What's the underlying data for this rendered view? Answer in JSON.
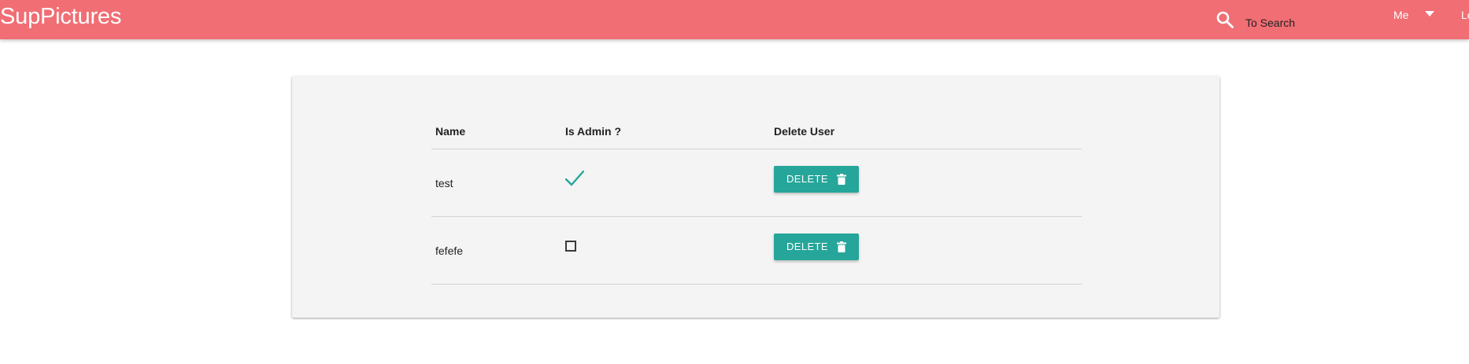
{
  "app": {
    "brand": "SupPictures"
  },
  "navbar": {
    "search_icon": "search-icon",
    "search_placeholder": "To Search",
    "me_label": "Me",
    "caret_icon": "caret-down-icon",
    "logout_label": "Logout"
  },
  "colors": {
    "navbar": "#f06e74",
    "accent": "#26a69a",
    "card": "#f4f4f4"
  },
  "table": {
    "headers": {
      "name": "Name",
      "is_admin": "Is Admin ?",
      "delete_user": "Delete User"
    },
    "rows": [
      {
        "name": "test",
        "is_admin": true,
        "delete_label": "DELETE",
        "delete_icon": "trash-icon"
      },
      {
        "name": "fefefe",
        "is_admin": false,
        "delete_label": "DELETE",
        "delete_icon": "trash-icon"
      }
    ]
  }
}
